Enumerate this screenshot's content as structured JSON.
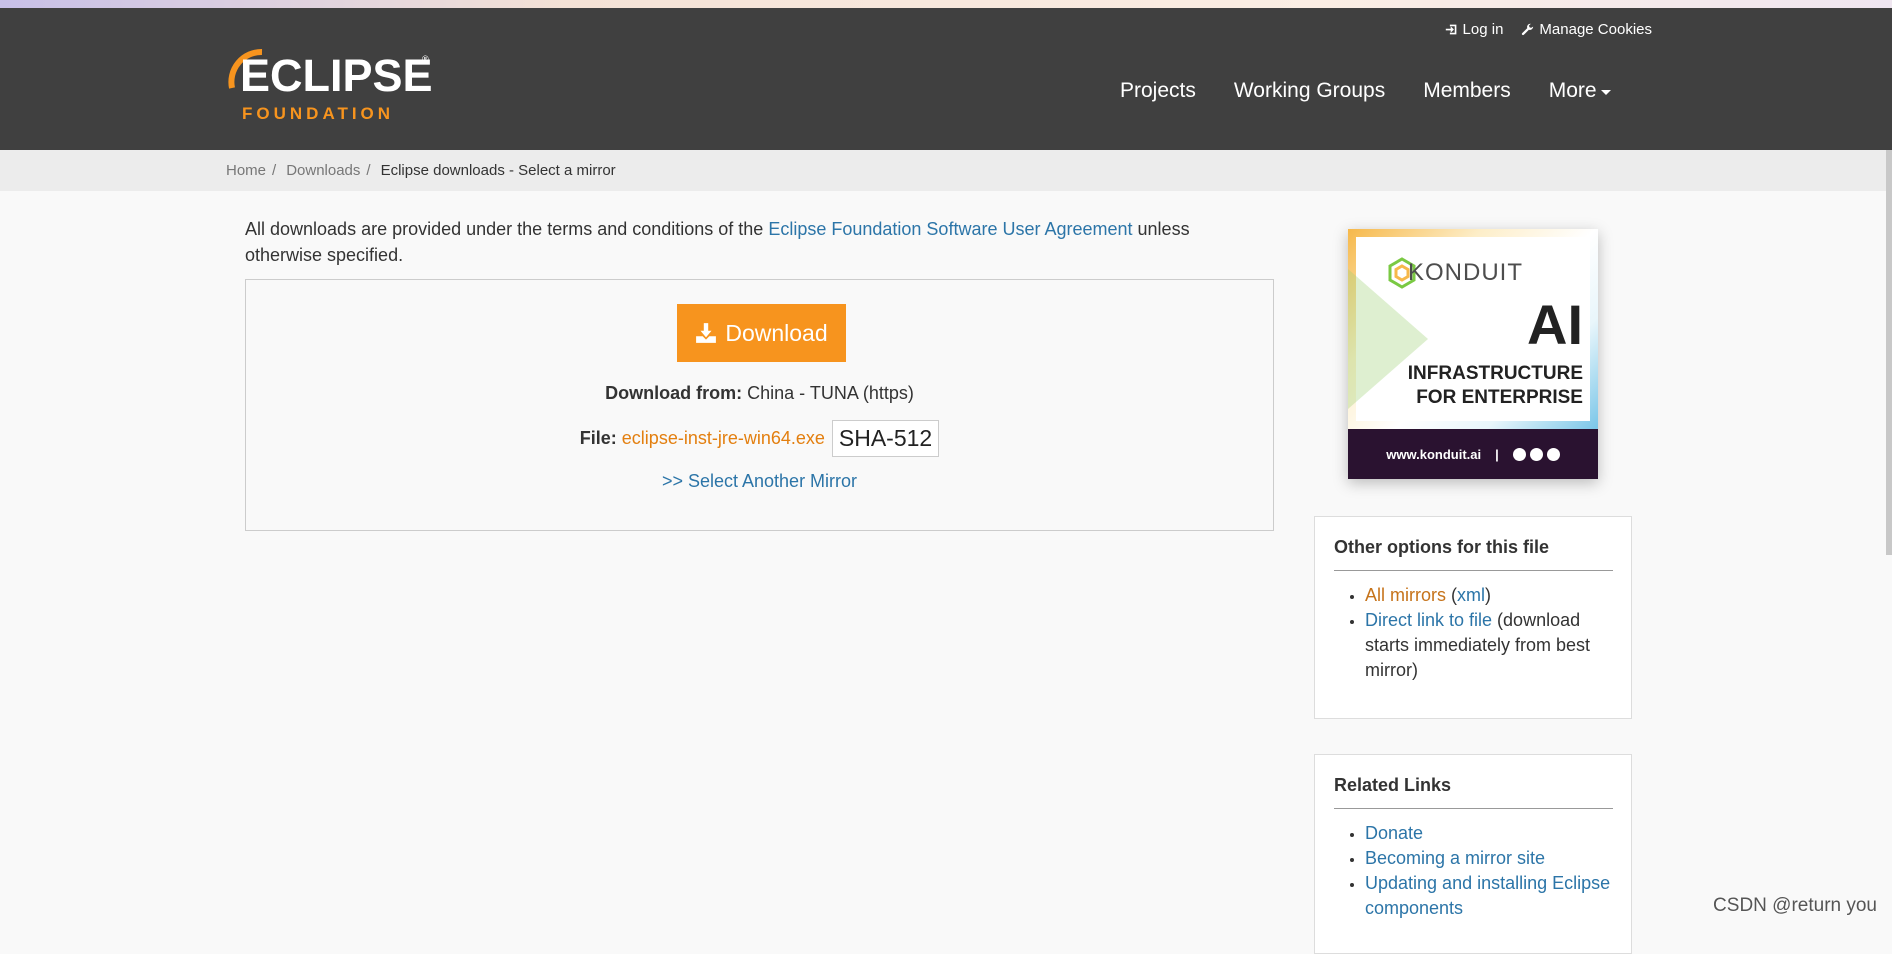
{
  "header": {
    "login_label": "Log in",
    "cookies_label": "Manage Cookies",
    "logo_word": "ECLIPSE",
    "logo_sub": "FOUNDATION",
    "nav": [
      "Projects",
      "Working Groups",
      "Members",
      "More"
    ]
  },
  "breadcrumb": {
    "home": "Home",
    "downloads": "Downloads",
    "current": "Eclipse downloads - Select a mirror"
  },
  "intro": {
    "before": "All downloads are provided under the terms and conditions of the ",
    "link": "Eclipse Foundation Software User Agreement",
    "after": " unless otherwise specified."
  },
  "download": {
    "button_label": "Download",
    "from_label": "Download from:",
    "from_value": " China - TUNA (https)",
    "file_label": "File:",
    "file_name": "eclipse-inst-jre-win64.exe",
    "hash_label": "SHA-512",
    "mirror_link": ">> Select Another Mirror"
  },
  "ad": {
    "brand": "KONDUIT",
    "headline": "AI",
    "line1": "INFRASTRUCTURE",
    "line2": "FOR ENTERPRISE",
    "url": "www.konduit.ai",
    "divider": "|"
  },
  "other_options": {
    "title": "Other options for this file",
    "all_mirrors": "All mirrors",
    "xml_open": " (",
    "xml": "xml",
    "xml_close": ")",
    "direct_link": "Direct link to file",
    "direct_note": " (download starts immediately from best mirror)"
  },
  "related": {
    "title": "Related Links",
    "items": [
      "Donate",
      "Becoming a mirror site",
      "Updating and installing Eclipse components"
    ]
  },
  "watermark": "CSDN @return you",
  "colors": {
    "header_bg": "#404040",
    "accent_orange": "#f7941e",
    "link_blue": "#2c75a8"
  }
}
